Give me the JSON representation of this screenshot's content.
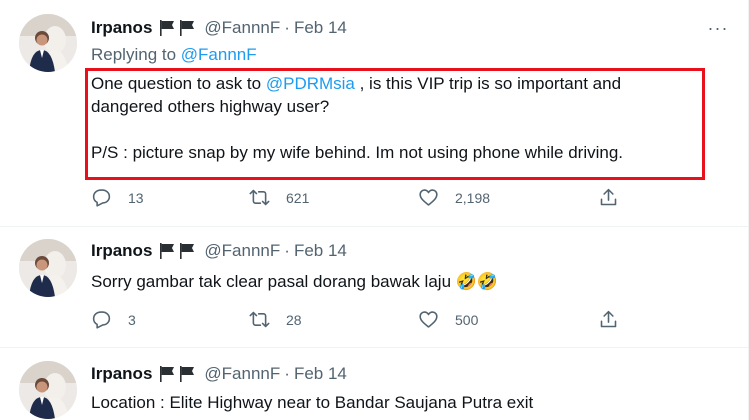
{
  "tweets": [
    {
      "name": "Irpanos",
      "handle": "@FannnF",
      "separator": "·",
      "date": "Feb 14",
      "replying_prefix": "Replying to ",
      "replying_to": "@FannnF",
      "text_before_mention": "One question to ask to ",
      "mention": "@PDRMsia",
      "text_after_mention": " , is this VIP trip is so important and\ndangered others highway user?\n\nP/S : picture snap by my wife behind. Im not using phone while driving.",
      "replies": "13",
      "retweets": "621",
      "likes": "2,198"
    },
    {
      "name": "Irpanos",
      "handle": "@FannnF",
      "separator": "·",
      "date": "Feb 14",
      "text": "Sorry gambar tak clear pasal dorang bawak laju ",
      "emoji": "🤣🤣",
      "replies": "3",
      "retweets": "28",
      "likes": "500"
    },
    {
      "name": "Irpanos",
      "handle": "@FannnF",
      "separator": "·",
      "date": "Feb 14",
      "text": "Location : Elite Highway near to Bandar Saujana Putra exit"
    }
  ],
  "icons": {
    "flag": "black-flag-icon",
    "more": "more-icon",
    "reply": "reply-icon",
    "retweet": "retweet-icon",
    "like": "heart-icon",
    "share": "share-icon"
  },
  "colors": {
    "link": "#1d9bf0",
    "highlight_border": "#e8111b",
    "secondary_text": "#536471",
    "divider": "#eff3f4"
  },
  "more_glyph": "···"
}
